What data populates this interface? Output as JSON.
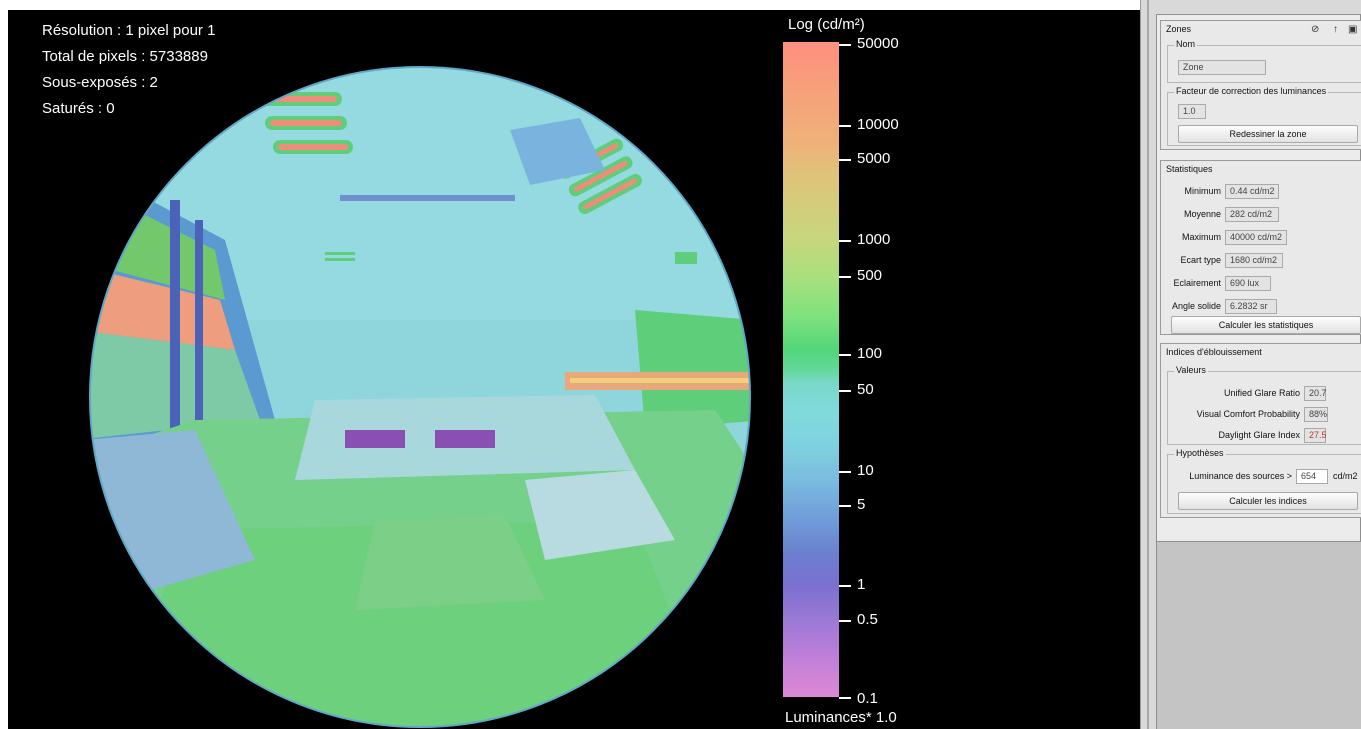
{
  "viewer": {
    "info": {
      "resolution": "Résolution : 1 pixel pour 1",
      "total_pixels": "Total de pixels : 5733889",
      "underexposed": "Sous-exposés : 2",
      "saturated": "Saturés : 0"
    },
    "scale": {
      "title": "Log (cd/m²)",
      "ticks": [
        "50000",
        "10000",
        "5000",
        "1000",
        "500",
        "100",
        "50",
        "10",
        "5",
        "1",
        "0.5",
        "0.1"
      ],
      "footer": "Luminances* 1.0"
    },
    "colors": {
      "background": "#000000",
      "high": "#ff8f7e",
      "mid": "#52d67a",
      "low": "#de88d6"
    }
  },
  "panel": {
    "zones": {
      "title": "Zones",
      "icons": [
        "eye-off-icon",
        "arrow-up-icon",
        "save-icon"
      ],
      "name_group": "Nom",
      "name_value": "Zone",
      "correction_group": "Facteur de correction des luminances",
      "correction_value": "1.0",
      "redraw_button": "Redessiner la zone"
    },
    "stats": {
      "title": "Statistiques",
      "rows": [
        {
          "label": "Minimum",
          "value": "0.44 cd/m2"
        },
        {
          "label": "Moyenne",
          "value": "282 cd/m2"
        },
        {
          "label": "Maximum",
          "value": "40000 cd/m2"
        },
        {
          "label": "Ecart type",
          "value": "1680 cd/m2"
        },
        {
          "label": "Eclairement",
          "value": "690 lux"
        },
        {
          "label": "Angle solide",
          "value": "6.2832 sr"
        }
      ],
      "compute_button": "Calculer les statistiques"
    },
    "glare": {
      "title": "Indices d'éblouissement",
      "values_group": "Valeurs",
      "rows": [
        {
          "label": "Unified Glare Ratio",
          "value": "20.7"
        },
        {
          "label": "Visual Comfort Probability",
          "value": "88%"
        },
        {
          "label": "Daylight Glare Index",
          "value": "27.5"
        }
      ],
      "dgi_color": "#c0392b",
      "hypotheses_group": "Hypothèses",
      "sources_label": "Luminance des sources >",
      "sources_value": "654",
      "sources_unit": "cd/m2",
      "compute_button": "Calculer les indices"
    }
  }
}
